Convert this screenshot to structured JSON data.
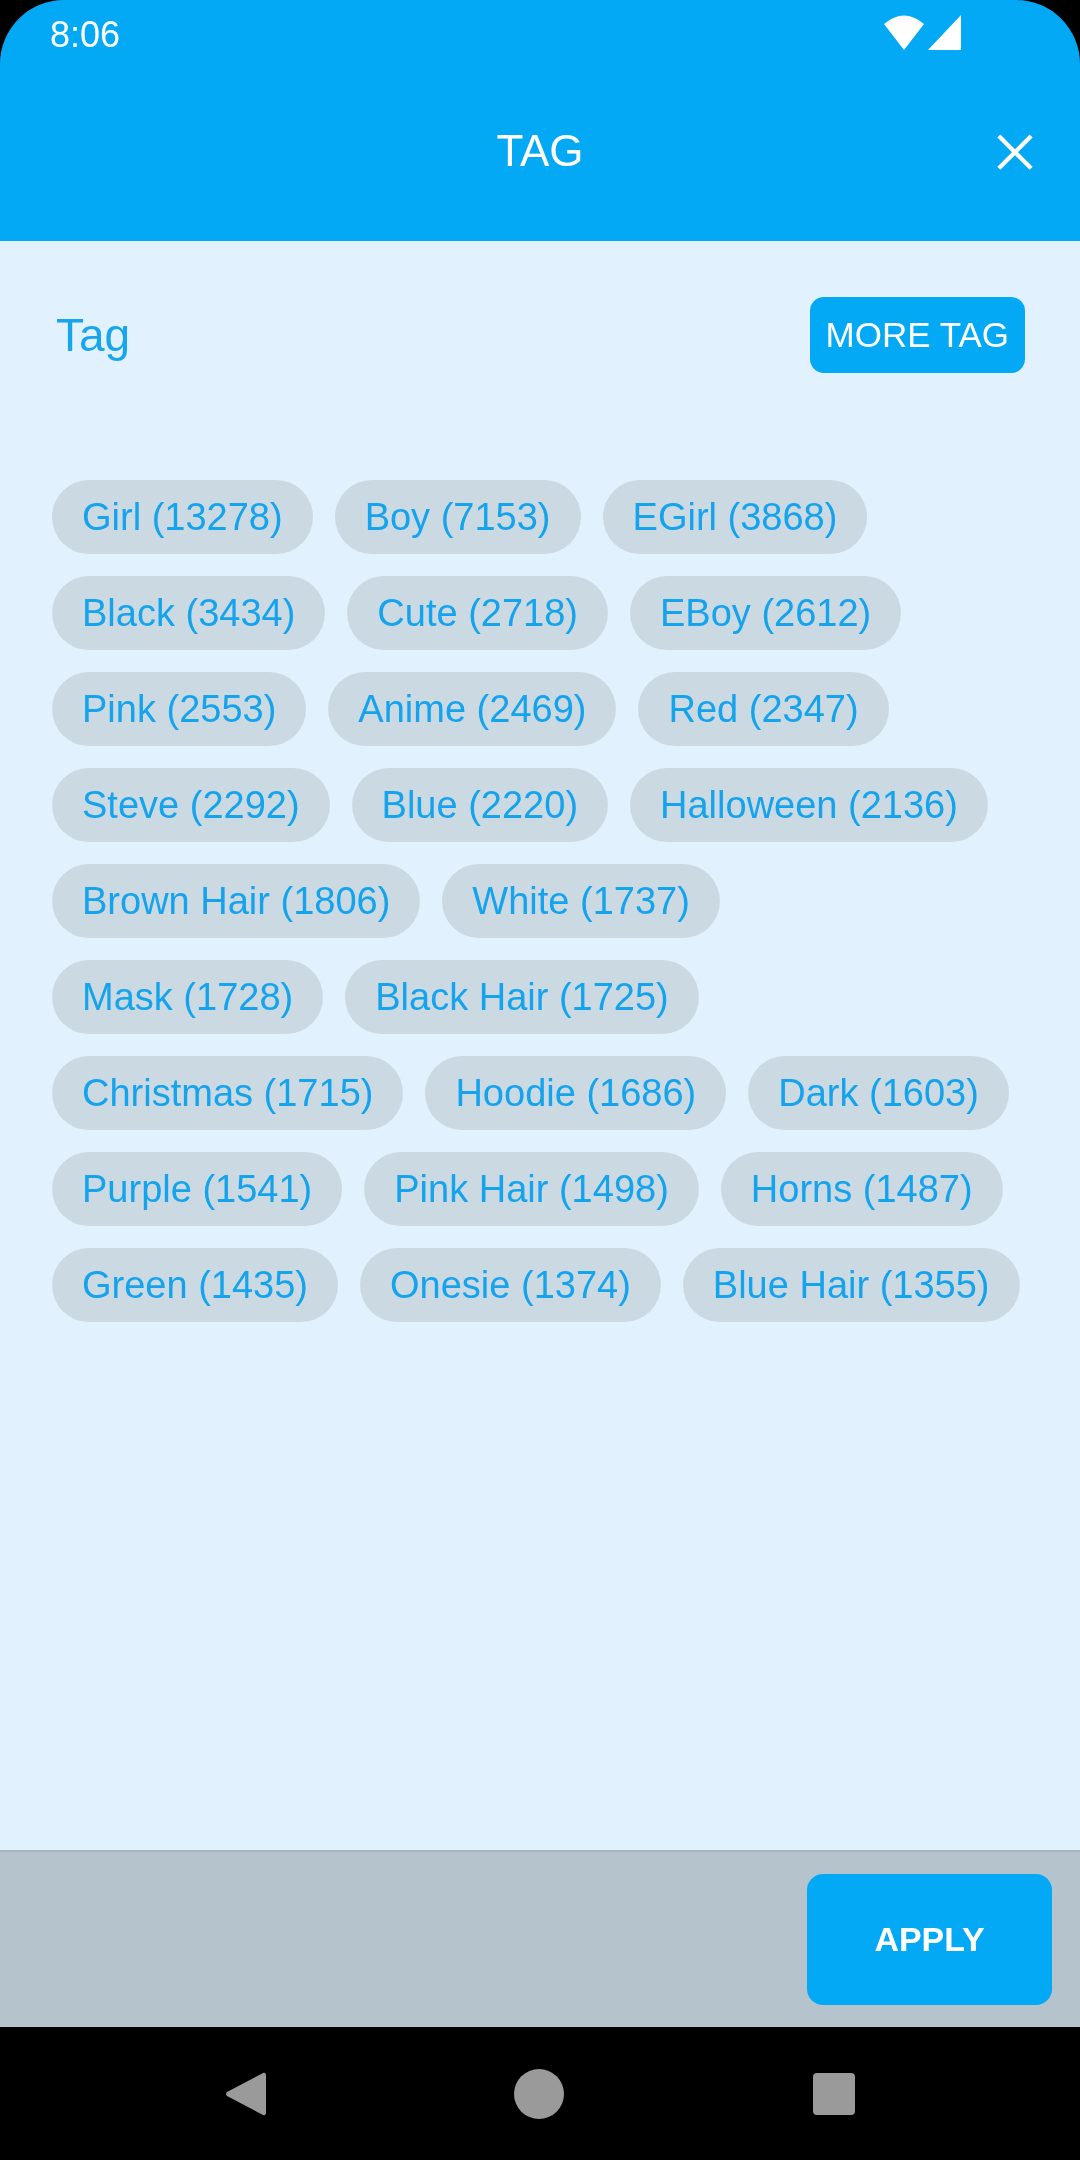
{
  "status_bar": {
    "time": "8:06"
  },
  "app_bar": {
    "title": "TAG"
  },
  "section": {
    "title": "Tag",
    "more_button": "MORE TAG"
  },
  "tags": [
    {
      "label": "Girl (13278)",
      "selected": false
    },
    {
      "label": "Boy (7153)",
      "selected": false
    },
    {
      "label": "EGirl (3868)",
      "selected": false
    },
    {
      "label": "Black (3434)",
      "selected": false
    },
    {
      "label": "Cute (2718)",
      "selected": false
    },
    {
      "label": "EBoy (2612)",
      "selected": false
    },
    {
      "label": "Pink (2553)",
      "selected": false
    },
    {
      "label": "Anime (2469)",
      "selected": false
    },
    {
      "label": "Red (2347)",
      "selected": false
    },
    {
      "label": "Steve (2292)",
      "selected": false
    },
    {
      "label": "Blue (2220)",
      "selected": false
    },
    {
      "label": "Halloween (2136)",
      "selected": false
    },
    {
      "label": "Brown Hair (1806)",
      "selected": false
    },
    {
      "label": "White (1737)",
      "selected": false
    },
    {
      "label": "Mask (1728)",
      "selected": false
    },
    {
      "label": "Black Hair (1725)",
      "selected": false
    },
    {
      "label": "Christmas (1715)",
      "selected": false
    },
    {
      "label": "Hoodie (1686)",
      "selected": false
    },
    {
      "label": "Dark (1603)",
      "selected": false
    },
    {
      "label": "Purple (1541)",
      "selected": false
    },
    {
      "label": "Pink Hair (1498)",
      "selected": false
    },
    {
      "label": "Horns (1487)",
      "selected": false
    },
    {
      "label": "Green (1435)",
      "selected": false
    },
    {
      "label": "Onesie (1374)",
      "selected": false
    },
    {
      "label": "Blue Hair (1355)",
      "selected": false
    }
  ],
  "footer": {
    "apply_button": "APPLY"
  }
}
